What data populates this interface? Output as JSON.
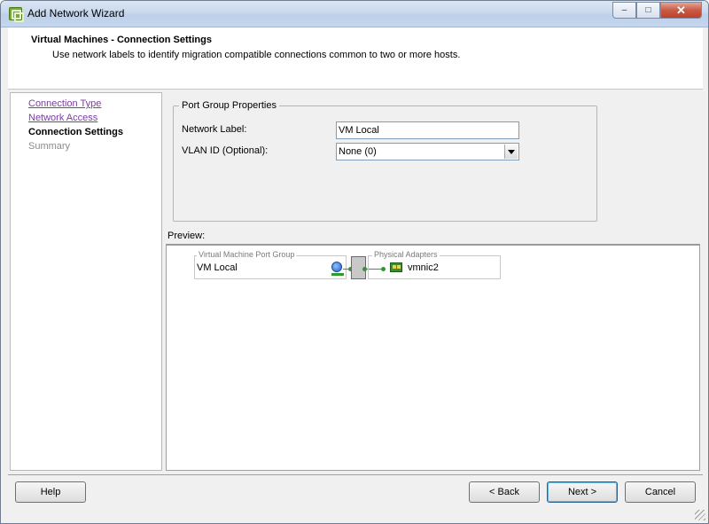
{
  "window": {
    "title": "Add Network Wizard",
    "minimize_label": "–",
    "maximize_label": "□",
    "close_label": "✕"
  },
  "header": {
    "title": "Virtual Machines - Connection Settings",
    "description": "Use network labels to identify migration compatible connections common to two or more hosts."
  },
  "nav": {
    "items": [
      {
        "label": "Connection Type",
        "state": "visited"
      },
      {
        "label": "Network Access",
        "state": "visited"
      },
      {
        "label": "Connection Settings",
        "state": "current"
      },
      {
        "label": "Summary",
        "state": "pending"
      }
    ]
  },
  "port_group": {
    "legend": "Port Group Properties",
    "network_label": {
      "label": "Network Label:",
      "value": "VM Local"
    },
    "vlan_id": {
      "label": "VLAN ID (Optional):",
      "value": "None (0)"
    }
  },
  "preview": {
    "label": "Preview:",
    "vm_port_group_legend": "Virtual Machine Port Group",
    "vm_port_group_name": "VM Local",
    "physical_adapters_legend": "Physical Adapters",
    "adapter_name": "vmnic2",
    "icons": [
      "virtual-machine-icon",
      "virtual-switch",
      "network-adapter-icon"
    ]
  },
  "buttons": {
    "help": "Help",
    "back": "< Back",
    "next": "Next >",
    "cancel": "Cancel"
  },
  "colors": {
    "link_visited": "#7b3ca3",
    "connection_wire": "#3a9a3a"
  }
}
